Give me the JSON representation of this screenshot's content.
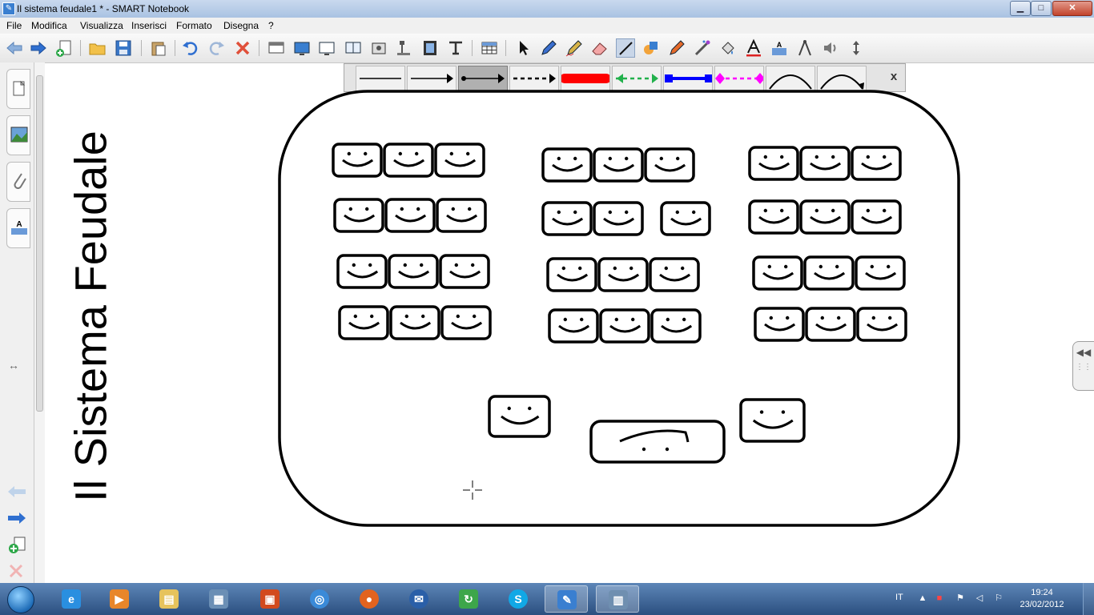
{
  "window": {
    "title": "Il sistema feudale1 * - SMART Notebook",
    "minimize": "▁",
    "maximize": "□",
    "close": "✕"
  },
  "menu": [
    "File",
    "Modifica",
    "Visualizza",
    "Inserisci",
    "Formato",
    "Disegna",
    "?"
  ],
  "toolbar_icons": [
    "back-icon",
    "forward-icon",
    "add-page-icon",
    "open-icon",
    "save-icon",
    "paste-icon",
    "undo-icon",
    "redo-icon",
    "delete-icon",
    "screen-shade-icon",
    "show-screen-icon",
    "full-screen-icon",
    "dual-page-icon",
    "screen-capture-icon",
    "document-camera-icon",
    "recorder-icon",
    "text-tool-icon",
    "table-icon",
    "select-icon",
    "pen-icon",
    "creative-pen-icon",
    "eraser-icon",
    "line-tool-icon",
    "shape-tool-icon",
    "magic-pen-icon",
    "shape-pen-icon",
    "fill-icon",
    "text-icon",
    "properties-icon",
    "measurement-tools-icon",
    "sound-icon",
    "toolbar-move-icon"
  ],
  "line_styles": [
    {
      "style": "solid",
      "color": "#000000",
      "start": "none",
      "end": "none"
    },
    {
      "style": "solid",
      "color": "#000000",
      "start": "none",
      "end": "arrow"
    },
    {
      "style": "solid",
      "color": "#000000",
      "start": "dot",
      "end": "arrow"
    },
    {
      "style": "dashed",
      "color": "#000000",
      "start": "none",
      "end": "arrow"
    },
    {
      "style": "thick",
      "color": "#ff0000",
      "start": "none",
      "end": "none"
    },
    {
      "style": "dashed",
      "color": "#22b14c",
      "start": "arrow",
      "end": "arrow"
    },
    {
      "style": "solid",
      "color": "#0000ff",
      "start": "square",
      "end": "square"
    },
    {
      "style": "dashed",
      "color": "#ff00ff",
      "start": "diamond",
      "end": "diamond"
    },
    {
      "style": "arc",
      "color": "#000000",
      "start": "none",
      "end": "none"
    },
    {
      "style": "arc",
      "color": "#000000",
      "start": "none",
      "end": "arrow"
    }
  ],
  "linebar_close": "x",
  "sidebar_tabs": [
    "page-sorter-icon",
    "gallery-icon",
    "attachments-icon",
    "properties-icon"
  ],
  "sidebar_bottom": [
    "previous-page-icon",
    "next-page-icon",
    "add-page-icon",
    "delete-page-icon"
  ],
  "page_title": "Il Sistema Feudale",
  "classroom": {
    "student_groups": 3,
    "rows_per_group": 4,
    "students_per_row": 3,
    "teachers": 2,
    "desk": 1
  },
  "taskbar": {
    "apps": [
      "internet-explorer-icon",
      "media-player-icon",
      "explorer-icon",
      "control-panel-icon",
      "office-icon",
      "itunes-icon",
      "firefox-icon",
      "thunderbird-icon",
      "media-app-icon",
      "skype-icon",
      "smart-notebook-icon",
      "smart-tools-icon"
    ],
    "lang": "IT",
    "time": "19:24",
    "date": "23/02/2012"
  },
  "colors": {
    "titlebar": "#a9c2e2",
    "taskbar": "#2b4f7f",
    "accent_blue": "#3a7fd0"
  }
}
